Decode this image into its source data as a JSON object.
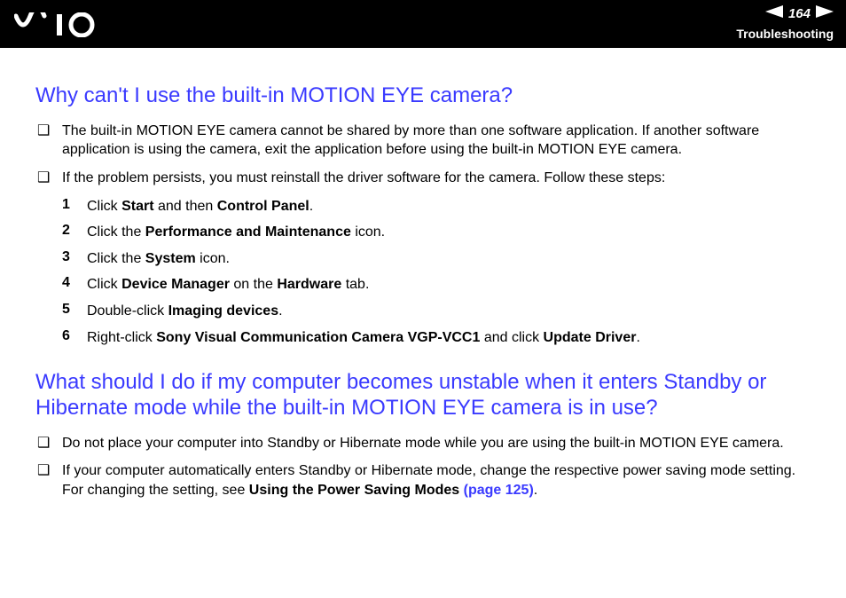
{
  "header": {
    "page_number": "164",
    "section": "Troubleshooting"
  },
  "q1": {
    "title": "Why can't I use the built-in MOTION EYE camera?",
    "bullets": [
      {
        "text": "The built-in MOTION EYE camera cannot be shared by more than one software application. If another software application is using the camera, exit the application before using the built-in MOTION EYE camera."
      },
      {
        "text": "If the problem persists, you must reinstall the driver software for the camera. Follow these steps:"
      }
    ],
    "steps": [
      {
        "n": "1",
        "pre": "Click ",
        "b1": "Start",
        "mid": " and then ",
        "b2": "Control Panel",
        "post": "."
      },
      {
        "n": "2",
        "pre": "Click the ",
        "b1": "Performance and Maintenance",
        "mid": " icon.",
        "b2": "",
        "post": ""
      },
      {
        "n": "3",
        "pre": "Click the ",
        "b1": "System",
        "mid": " icon.",
        "b2": "",
        "post": ""
      },
      {
        "n": "4",
        "pre": "Click ",
        "b1": "Device Manager",
        "mid": " on the ",
        "b2": "Hardware",
        "post": " tab."
      },
      {
        "n": "5",
        "pre": "Double-click ",
        "b1": "Imaging devices",
        "mid": ".",
        "b2": "",
        "post": ""
      },
      {
        "n": "6",
        "pre": "Right-click ",
        "b1": "Sony Visual Communication Camera VGP-VCC1",
        "mid": " and click ",
        "b2": "Update Driver",
        "post": "."
      }
    ]
  },
  "q2": {
    "title": "What should I do if my computer becomes unstable when it enters Standby or Hibernate mode while the built-in MOTION EYE camera is in use?",
    "bullets": [
      {
        "text": "Do not place your computer into Standby or Hibernate mode while you are using the built-in MOTION EYE camera."
      },
      {
        "pre": "If your computer automatically enters Standby or Hibernate mode, change the respective power saving mode setting. For changing the setting, see ",
        "bold": "Using the Power Saving Modes ",
        "link": "(page 125)",
        "post": "."
      }
    ]
  }
}
